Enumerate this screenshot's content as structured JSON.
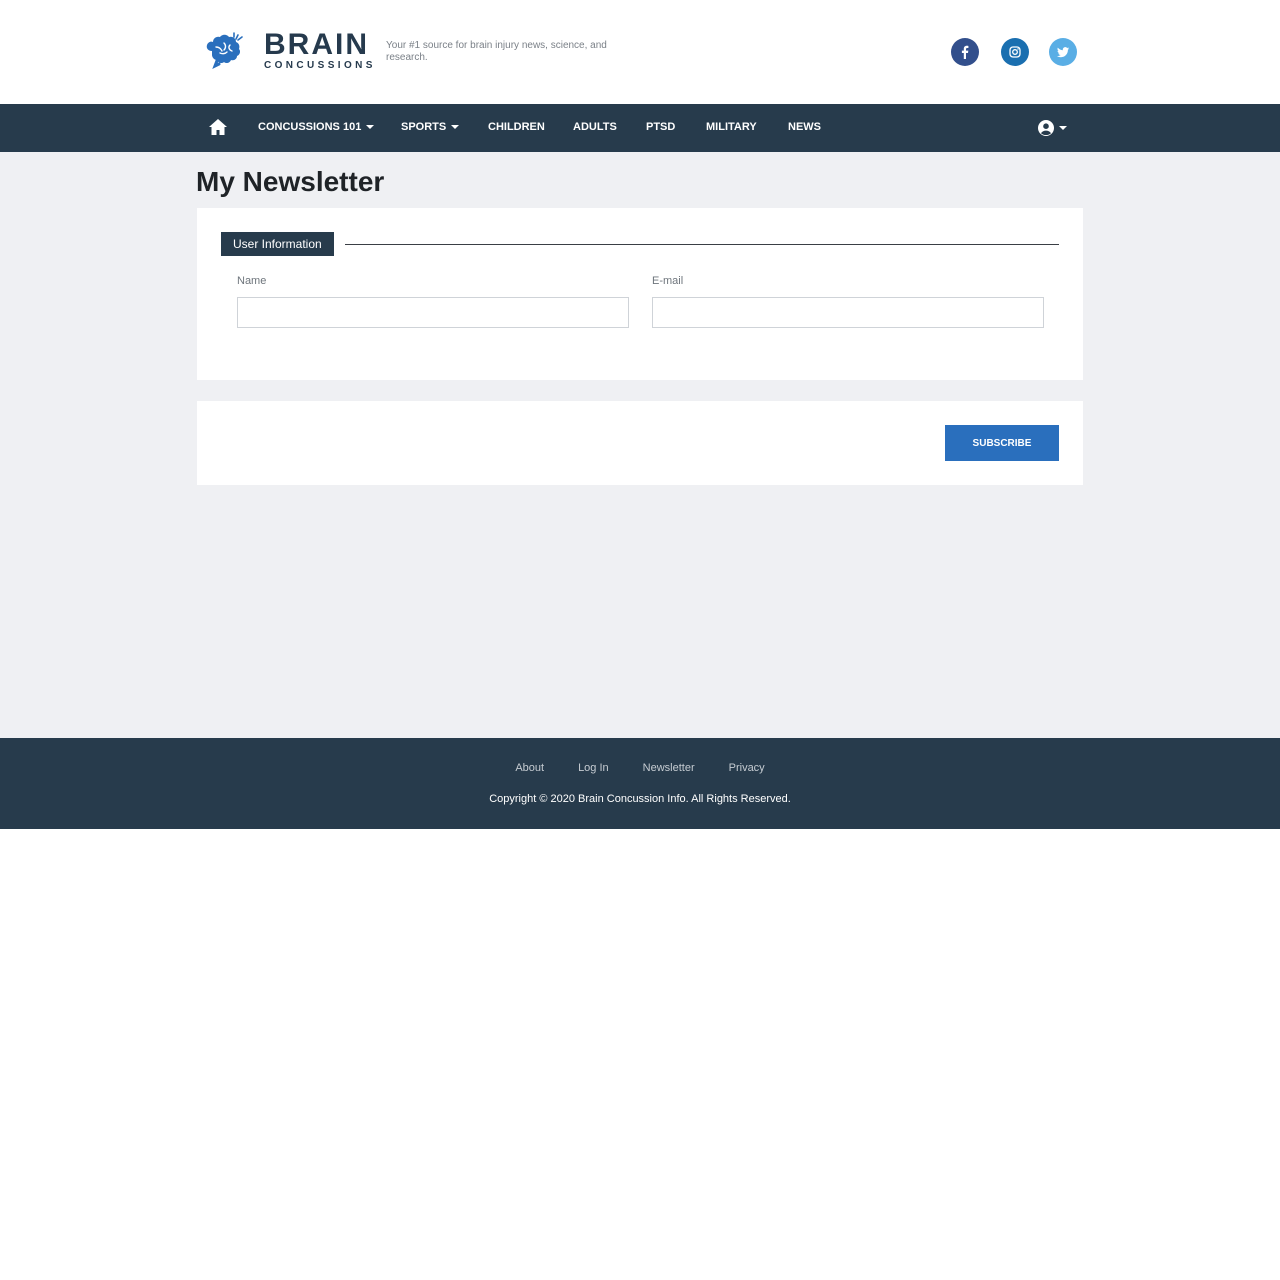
{
  "header": {
    "logo_title": "BRAIN",
    "logo_subtitle": "CONCUSSIONS",
    "tagline": "Your #1 source for brain injury news, science, and research.",
    "social": [
      {
        "icon": "facebook-icon",
        "color": "#324f8c"
      },
      {
        "icon": "instagram-icon",
        "color": "#1a6fb0"
      },
      {
        "icon": "twitter-icon",
        "color": "#5aaee5"
      }
    ]
  },
  "nav": {
    "home_icon": "home-icon",
    "items": [
      {
        "label": "CONCUSSIONS 101",
        "dropdown": true
      },
      {
        "label": "SPORTS",
        "dropdown": true
      },
      {
        "label": "CHILDREN",
        "dropdown": false
      },
      {
        "label": "ADULTS",
        "dropdown": false
      },
      {
        "label": "PTSD",
        "dropdown": false
      },
      {
        "label": "MILITARY",
        "dropdown": false
      },
      {
        "label": "NEWS",
        "dropdown": false
      }
    ],
    "user_icon": "user-circle-icon"
  },
  "main": {
    "title": "My Newsletter",
    "section_label": "User Information",
    "fields": {
      "name_label": "Name",
      "name_value": "",
      "email_label": "E-mail",
      "email_value": ""
    },
    "subscribe_label": "SUBSCRIBE"
  },
  "footer": {
    "links": [
      "About",
      "Log In",
      "Newsletter",
      "Privacy"
    ],
    "copyright": "Copyright © 2020 Brain Concussion Info. All Rights Reserved."
  },
  "colors": {
    "navy": "#273b4c",
    "accent_blue": "#2a6fbd",
    "page_bg": "#eff0f3"
  }
}
